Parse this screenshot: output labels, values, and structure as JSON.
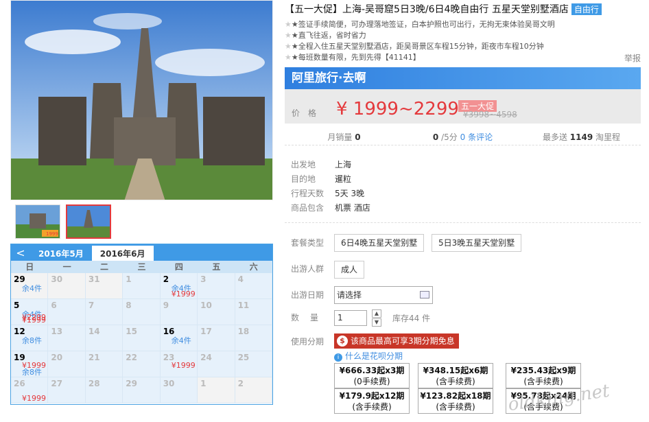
{
  "gallery": {
    "thumb1_badge": "1999"
  },
  "calendar": {
    "prev": "<",
    "tabs": [
      "2016年5月",
      "2016年6月"
    ],
    "weekdays": [
      "日",
      "一",
      "二",
      "三",
      "四",
      "五",
      "六"
    ],
    "rows": [
      [
        {
          "d": "29",
          "s": "余4件",
          "has": true
        },
        {
          "d": "30"
        },
        {
          "d": "31"
        },
        {
          "d": "1",
          "cur": true
        },
        {
          "d": "2",
          "s": "余4件",
          "p": "¥1999",
          "has": true,
          "cur": true
        },
        {
          "d": "3",
          "cur": true
        },
        {
          "d": "4",
          "cur": true
        }
      ],
      [
        {
          "d": "5",
          "s": "余4件",
          "p": "¥1999",
          "has": true,
          "cur": true
        },
        {
          "d": "6",
          "cur": true
        },
        {
          "d": "7",
          "cur": true
        },
        {
          "d": "8",
          "cur": true
        },
        {
          "d": "9",
          "cur": true
        },
        {
          "d": "10",
          "cur": true
        },
        {
          "d": "11",
          "cur": true
        }
      ],
      [
        {
          "d": "12",
          "s": "余8件",
          "has": true,
          "cur": true
        },
        {
          "d": "13",
          "cur": true
        },
        {
          "d": "14",
          "cur": true
        },
        {
          "d": "15",
          "cur": true
        },
        {
          "d": "16",
          "s": "余4件",
          "has": true,
          "cur": true
        },
        {
          "d": "17",
          "cur": true
        },
        {
          "d": "18",
          "cur": true
        }
      ],
      [
        {
          "d": "19",
          "s": "¥1999",
          "has": true,
          "cur": true
        },
        {
          "d": "20",
          "cur": true
        },
        {
          "d": "21",
          "cur": true
        },
        {
          "d": "22",
          "cur": true
        },
        {
          "d": "23",
          "s": "¥1999",
          "cur": true
        },
        {
          "d": "24",
          "cur": true
        },
        {
          "d": "25",
          "cur": true
        }
      ],
      [
        {
          "d": "26",
          "p": "¥1999",
          "cur": true
        },
        {
          "d": "27",
          "cur": true
        },
        {
          "d": "28",
          "cur": true
        },
        {
          "d": "29",
          "cur": true
        },
        {
          "d": "30",
          "cur": true
        },
        {
          "d": "1"
        },
        {
          "d": "2"
        }
      ]
    ],
    "extra": {
      "r1_price": "¥2299",
      "r3_stock": "余8件",
      "r4_stock": "余8件"
    }
  },
  "product": {
    "title": "【五一大促】上海-吴哥窟5日3晚/6日4晚自由行 五星天堂别墅酒店",
    "tag": "自由行",
    "features": [
      "★签证手续简便，可办理落地签证，白本护照也可出行，无拘无束体验吴哥文明",
      "★直飞往返，省时省力",
      "★全程入住五星天堂别墅酒店，距吴哥景区车程15分钟，距夜市车程10分钟",
      "★每班数量有限，先到先得【41141】"
    ],
    "report": "举报",
    "banner": "阿里旅行·去啊",
    "price_label": "价格",
    "price": "¥ 1999~2299",
    "promo": "五一大促",
    "old_price": "¥3998~4598",
    "stats": {
      "sales_label": "月销量",
      "sales": "0",
      "score": "0",
      "score_unit": "/5分",
      "reviews": "0 条评论",
      "points_label": "最多送",
      "points": "1149",
      "points_unit": "淘里程"
    },
    "info": [
      {
        "k": "出发地",
        "v": "上海"
      },
      {
        "k": "目的地",
        "v": "暹粒"
      },
      {
        "k": "行程天数",
        "v": "5天 3晚"
      },
      {
        "k": "商品包含",
        "v": "机票 酒店"
      }
    ],
    "form": {
      "package_label": "套餐类型",
      "packages": [
        "6日4晚五星天堂别墅",
        "5日3晚五星天堂别墅"
      ],
      "people_label": "出游人群",
      "people": "成人",
      "date_label": "出游日期",
      "date_placeholder": "请选择",
      "qty_label": "数量",
      "qty": "1",
      "stock": "库存44 件",
      "install_label": "使用分期",
      "install_banner": "该商品最高可享3期分期免息",
      "install_icon": "$",
      "what": "什么是花呗分期"
    },
    "installments": [
      {
        "l1": "¥666.33起x3期",
        "l2": "(0手续费)"
      },
      {
        "l1": "¥348.15起x6期",
        "l2": "(含手续费)"
      },
      {
        "l1": "¥235.43起x9期",
        "l2": "(含手续费)"
      },
      {
        "l1": "¥179.9起x12期",
        "l2": "(含手续费)"
      },
      {
        "l1": "¥123.82起x18期",
        "l2": "(含手续费)"
      },
      {
        "l1": "¥95.78起x24期",
        "l2": "(含手续费)"
      }
    ]
  },
  "watermark": "oldking.net"
}
